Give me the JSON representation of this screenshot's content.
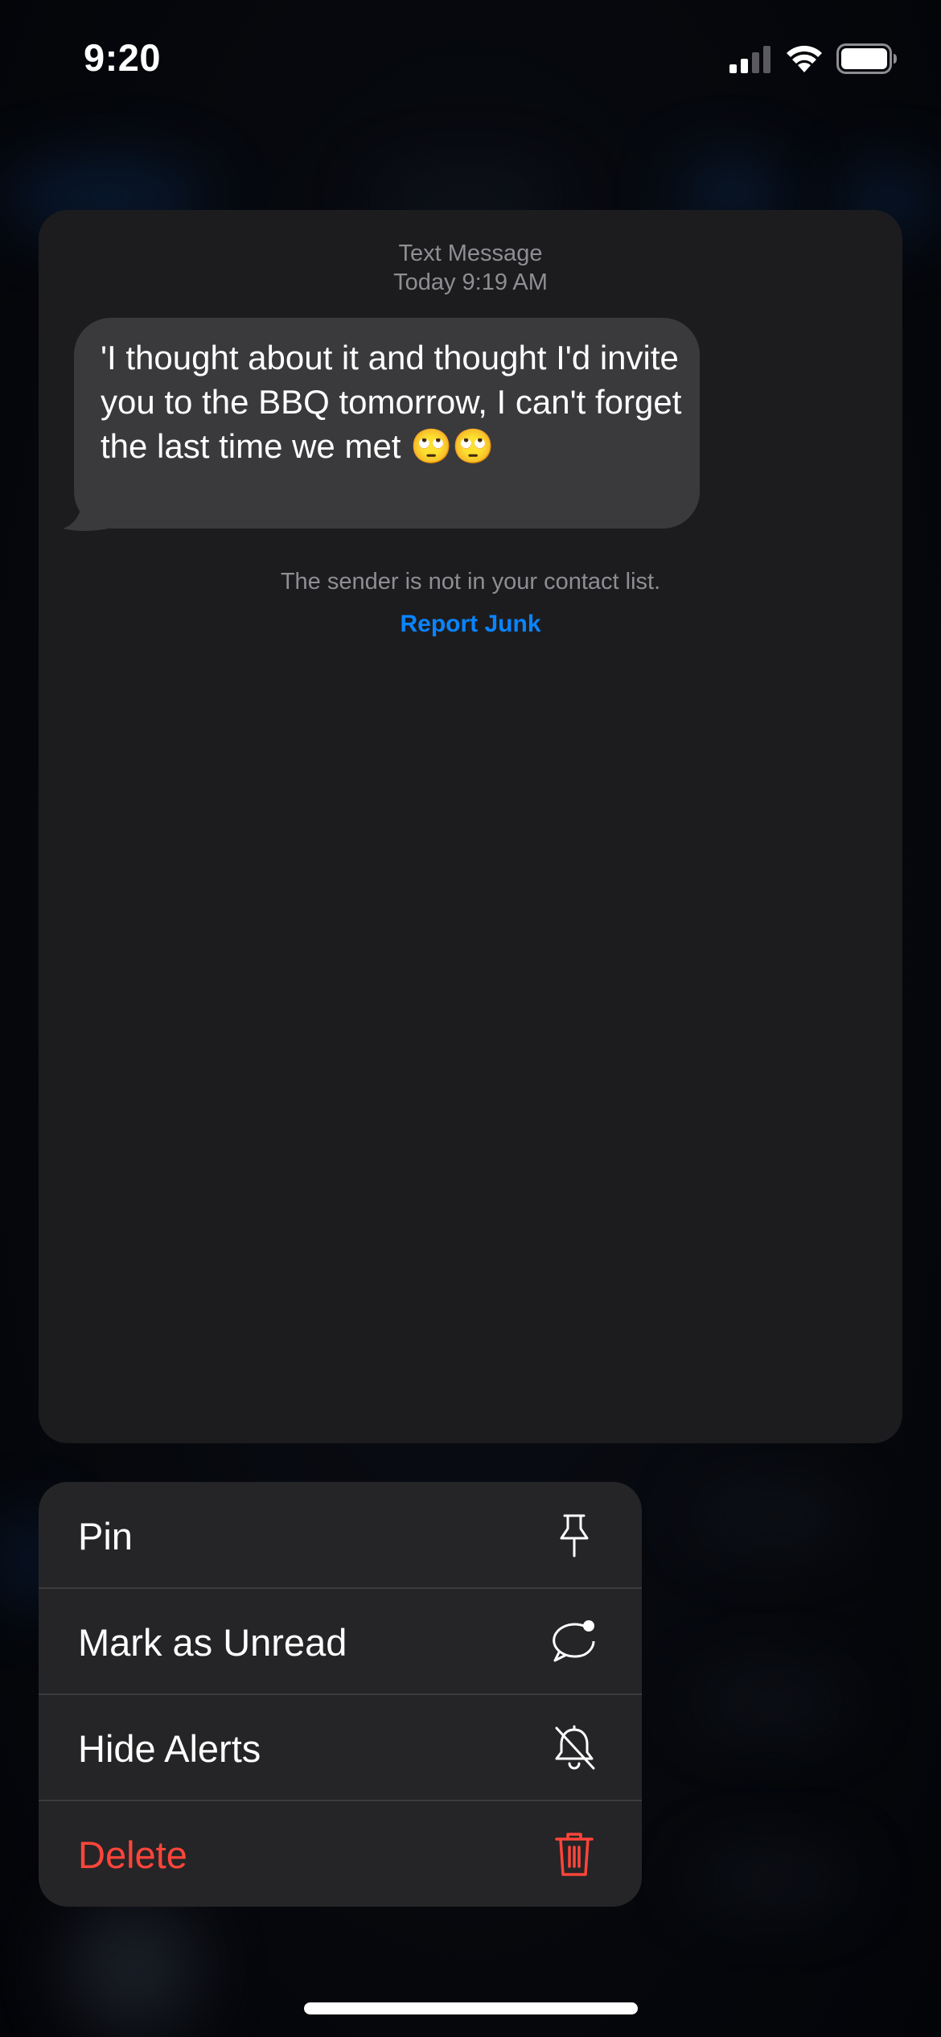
{
  "status_bar": {
    "time": "9:20",
    "icons": [
      "signal-icon",
      "wifi-icon",
      "battery-icon"
    ]
  },
  "preview": {
    "header_type": "Text Message",
    "header_time": "Today 9:19 AM",
    "message_text": "'I thought about it and thought I'd invite you to the BBQ tomorrow, I can't forget the last time we met 🙄🙄",
    "notice": "The sender is not in your contact list.",
    "report_link": "Report Junk"
  },
  "menu": {
    "items": [
      {
        "label": "Pin",
        "icon": "pin-icon"
      },
      {
        "label": "Mark as Unread",
        "icon": "unread-bubble-icon"
      },
      {
        "label": "Hide Alerts",
        "icon": "bell-slash-icon"
      },
      {
        "label": "Delete",
        "icon": "trash-icon"
      }
    ]
  },
  "colors": {
    "link": "#0a84ff",
    "danger": "#ff453a",
    "bubble": "#3a3a3c",
    "card": "#1c1c1e",
    "menu": "#252527"
  }
}
